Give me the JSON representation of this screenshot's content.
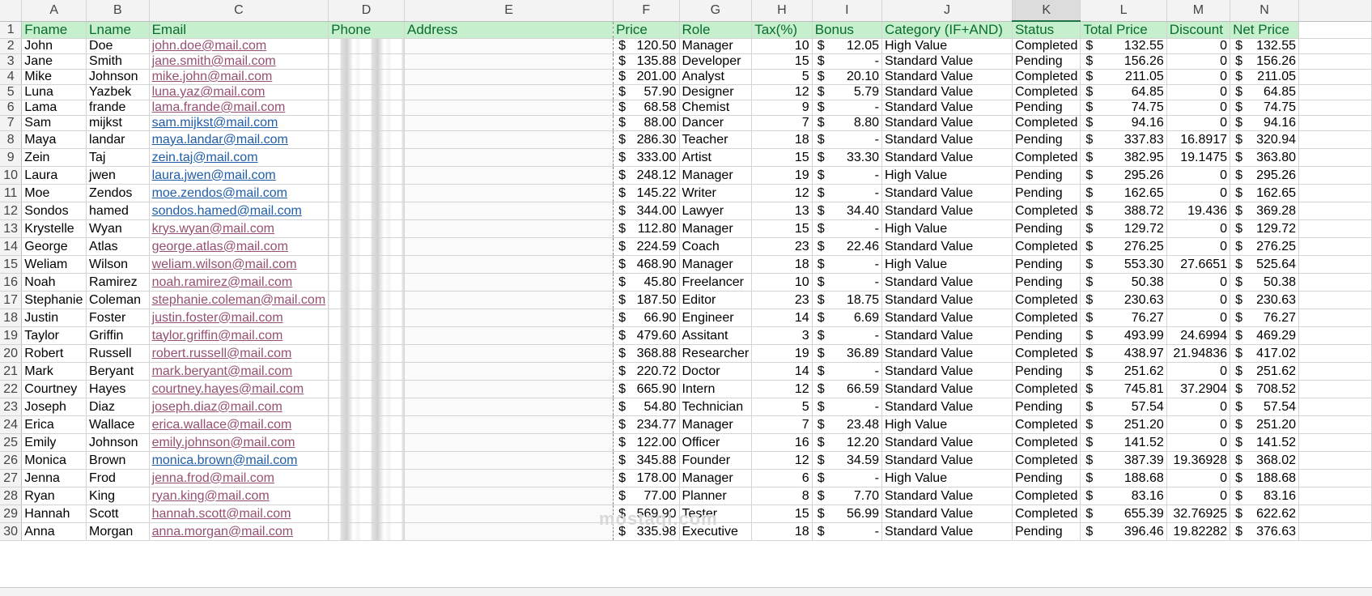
{
  "columns": [
    "A",
    "B",
    "C",
    "D",
    "E",
    "F",
    "G",
    "H",
    "I",
    "J",
    "K",
    "L",
    "M",
    "N"
  ],
  "selected_column": "K",
  "headers": [
    "Fname",
    "Lname",
    "Email",
    "Phone",
    "Address",
    "Price",
    "Role",
    "Tax(%)",
    "Bonus",
    "Category (IF+AND)",
    "Status",
    "Total Price",
    "Discount",
    "Net Price"
  ],
  "currency_symbol": "$",
  "header_fill_color": "#c6efce",
  "header_text_color": "#0a6c2b",
  "watermark": "mostaql.com",
  "rows": [
    {
      "row": "2",
      "fname": "John",
      "lname": "Doe",
      "email": "john.doe@mail.com",
      "price": "120.50",
      "role": "Manager",
      "tax": "10",
      "bonus": "12.05",
      "category": "High Value",
      "status": "Completed",
      "total": "132.55",
      "discount": "0",
      "net": "132.55"
    },
    {
      "row": "3",
      "fname": "Jane",
      "lname": "Smith",
      "email": "jane.smith@mail.com",
      "price": "135.88",
      "role": "Developer",
      "tax": "15",
      "bonus": "-",
      "category": "Standard Value",
      "status": "Pending",
      "total": "156.26",
      "discount": "0",
      "net": "156.26"
    },
    {
      "row": "4",
      "fname": "Mike",
      "lname": "Johnson",
      "email": "mike.john@mail.com",
      "price": "201.00",
      "role": "Analyst",
      "tax": "5",
      "bonus": "20.10",
      "category": "Standard Value",
      "status": "Completed",
      "total": "211.05",
      "discount": "0",
      "net": "211.05"
    },
    {
      "row": "5",
      "fname": "Luna",
      "lname": "Yazbek",
      "email": "luna.yaz@mail.com",
      "price": "57.90",
      "role": "Designer",
      "tax": "12",
      "bonus": "5.79",
      "category": "Standard Value",
      "status": "Completed",
      "total": "64.85",
      "discount": "0",
      "net": "64.85"
    },
    {
      "row": "6",
      "fname": "Lama",
      "lname": "frande",
      "email": "lama.frande@mail.com",
      "price": "68.58",
      "role": "Chemist",
      "tax": "9",
      "bonus": "-",
      "category": "Standard Value",
      "status": "Pending",
      "total": "74.75",
      "discount": "0",
      "net": "74.75"
    },
    {
      "row": "7",
      "fname": "Sam",
      "lname": "mijkst",
      "email": "sam.mijkst@mail.com",
      "price": "88.00",
      "role": "Dancer",
      "tax": "7",
      "bonus": "8.80",
      "category": "Standard Value",
      "status": "Completed",
      "total": "94.16",
      "discount": "0",
      "net": "94.16"
    },
    {
      "row": "8",
      "fname": "Maya",
      "lname": "landar",
      "email": "maya.landar@mail.com",
      "price": "286.30",
      "role": "Teacher",
      "tax": "18",
      "bonus": "-",
      "category": "Standard Value",
      "status": "Pending",
      "total": "337.83",
      "discount": "16.8917",
      "net": "320.94"
    },
    {
      "row": "9",
      "fname": "Zein",
      "lname": "Taj",
      "email": "zein.taj@mail.com",
      "price": "333.00",
      "role": "Artist",
      "tax": "15",
      "bonus": "33.30",
      "category": "Standard Value",
      "status": "Completed",
      "total": "382.95",
      "discount": "19.1475",
      "net": "363.80"
    },
    {
      "row": "10",
      "fname": "Laura",
      "lname": "jwen",
      "email": "laura.jwen@mail.com",
      "price": "248.12",
      "role": "Manager",
      "tax": "19",
      "bonus": "-",
      "category": "High Value",
      "status": "Pending",
      "total": "295.26",
      "discount": "0",
      "net": "295.26"
    },
    {
      "row": "11",
      "fname": "Moe",
      "lname": "Zendos",
      "email": "moe.zendos@mail.com",
      "price": "145.22",
      "role": "Writer",
      "tax": "12",
      "bonus": "-",
      "category": "Standard Value",
      "status": "Pending",
      "total": "162.65",
      "discount": "0",
      "net": "162.65"
    },
    {
      "row": "12",
      "fname": "Sondos",
      "lname": "hamed",
      "email": "sondos.hamed@mail.com",
      "price": "344.00",
      "role": "Lawyer",
      "tax": "13",
      "bonus": "34.40",
      "category": "Standard Value",
      "status": "Completed",
      "total": "388.72",
      "discount": "19.436",
      "net": "369.28"
    },
    {
      "row": "13",
      "fname": "Krystelle",
      "lname": "Wyan",
      "email": "krys.wyan@mail.com",
      "price": "112.80",
      "role": "Manager",
      "tax": "15",
      "bonus": "-",
      "category": "High Value",
      "status": "Pending",
      "total": "129.72",
      "discount": "0",
      "net": "129.72"
    },
    {
      "row": "14",
      "fname": "George",
      "lname": "Atlas",
      "email": "george.atlas@mail.com",
      "price": "224.59",
      "role": "Coach",
      "tax": "23",
      "bonus": "22.46",
      "category": "Standard Value",
      "status": "Completed",
      "total": "276.25",
      "discount": "0",
      "net": "276.25"
    },
    {
      "row": "15",
      "fname": "Weliam",
      "lname": "Wilson",
      "email": "weliam.wilson@mail.com",
      "price": "468.90",
      "role": "Manager",
      "tax": "18",
      "bonus": "-",
      "category": "High Value",
      "status": "Pending",
      "total": "553.30",
      "discount": "27.6651",
      "net": "525.64"
    },
    {
      "row": "16",
      "fname": "Noah",
      "lname": "Ramirez",
      "email": "noah.ramirez@mail.com",
      "price": "45.80",
      "role": "Freelancer",
      "tax": "10",
      "bonus": "-",
      "category": "Standard Value",
      "status": "Pending",
      "total": "50.38",
      "discount": "0",
      "net": "50.38"
    },
    {
      "row": "17",
      "fname": "Stephanie",
      "lname": "Coleman",
      "email": "stephanie.coleman@mail.com",
      "price": "187.50",
      "role": "Editor",
      "tax": "23",
      "bonus": "18.75",
      "category": "Standard Value",
      "status": "Completed",
      "total": "230.63",
      "discount": "0",
      "net": "230.63"
    },
    {
      "row": "18",
      "fname": "Justin",
      "lname": "Foster",
      "email": "justin.foster@mail.com",
      "price": "66.90",
      "role": "Engineer",
      "tax": "14",
      "bonus": "6.69",
      "category": "Standard Value",
      "status": "Completed",
      "total": "76.27",
      "discount": "0",
      "net": "76.27"
    },
    {
      "row": "19",
      "fname": "Taylor",
      "lname": "Griffin",
      "email": "taylor.griffin@mail.com",
      "price": "479.60",
      "role": "Assitant",
      "tax": "3",
      "bonus": "-",
      "category": "Standard Value",
      "status": "Pending",
      "total": "493.99",
      "discount": "24.6994",
      "net": "469.29"
    },
    {
      "row": "20",
      "fname": "Robert",
      "lname": "Russell",
      "email": "robert.russell@mail.com",
      "price": "368.88",
      "role": "Researcher",
      "tax": "19",
      "bonus": "36.89",
      "category": "Standard Value",
      "status": "Completed",
      "total": "438.97",
      "discount": "21.94836",
      "net": "417.02"
    },
    {
      "row": "21",
      "fname": "Mark",
      "lname": "Beryant",
      "email": "mark.beryant@mail.com",
      "price": "220.72",
      "role": "Doctor",
      "tax": "14",
      "bonus": "-",
      "category": "Standard Value",
      "status": "Pending",
      "total": "251.62",
      "discount": "0",
      "net": "251.62"
    },
    {
      "row": "22",
      "fname": "Courtney",
      "lname": "Hayes",
      "email": "courtney.hayes@mail.com",
      "price": "665.90",
      "role": "Intern",
      "tax": "12",
      "bonus": "66.59",
      "category": "Standard Value",
      "status": "Completed",
      "total": "745.81",
      "discount": "37.2904",
      "net": "708.52"
    },
    {
      "row": "23",
      "fname": "Joseph",
      "lname": "Diaz",
      "email": "joseph.diaz@mail.com",
      "price": "54.80",
      "role": "Technician",
      "tax": "5",
      "bonus": "-",
      "category": "Standard Value",
      "status": "Pending",
      "total": "57.54",
      "discount": "0",
      "net": "57.54"
    },
    {
      "row": "24",
      "fname": "Erica",
      "lname": "Wallace",
      "email": "erica.wallace@mail.com",
      "price": "234.77",
      "role": "Manager",
      "tax": "7",
      "bonus": "23.48",
      "category": "High Value",
      "status": "Completed",
      "total": "251.20",
      "discount": "0",
      "net": "251.20"
    },
    {
      "row": "25",
      "fname": "Emily",
      "lname": "Johnson",
      "email": "emily.johnson@mail.com",
      "price": "122.00",
      "role": "Officer",
      "tax": "16",
      "bonus": "12.20",
      "category": "Standard Value",
      "status": "Completed",
      "total": "141.52",
      "discount": "0",
      "net": "141.52"
    },
    {
      "row": "26",
      "fname": "Monica",
      "lname": "Brown",
      "email": "monica.brown@mail.com",
      "price": "345.88",
      "role": "Founder",
      "tax": "12",
      "bonus": "34.59",
      "category": "Standard Value",
      "status": "Completed",
      "total": "387.39",
      "discount": "19.36928",
      "net": "368.02"
    },
    {
      "row": "27",
      "fname": "Jenna",
      "lname": "Frod",
      "email": "jenna.frod@mail.com",
      "price": "178.00",
      "role": "Manager",
      "tax": "6",
      "bonus": "-",
      "category": "High Value",
      "status": "Pending",
      "total": "188.68",
      "discount": "0",
      "net": "188.68"
    },
    {
      "row": "28",
      "fname": "Ryan",
      "lname": "King",
      "email": "ryan.king@mail.com",
      "price": "77.00",
      "role": "Planner",
      "tax": "8",
      "bonus": "7.70",
      "category": "Standard Value",
      "status": "Completed",
      "total": "83.16",
      "discount": "0",
      "net": "83.16"
    },
    {
      "row": "29",
      "fname": "Hannah",
      "lname": "Scott",
      "email": "hannah.scott@mail.com",
      "price": "569.90",
      "role": "Tester",
      "tax": "15",
      "bonus": "56.99",
      "category": "Standard Value",
      "status": "Completed",
      "total": "655.39",
      "discount": "32.76925",
      "net": "622.62"
    },
    {
      "row": "30",
      "fname": "Anna",
      "lname": "Morgan",
      "email": "anna.morgan@mail.com",
      "price": "335.98",
      "role": "Executive",
      "tax": "18",
      "bonus": "-",
      "category": "Standard Value",
      "status": "Pending",
      "total": "396.46",
      "discount": "19.82282",
      "net": "376.63"
    }
  ]
}
